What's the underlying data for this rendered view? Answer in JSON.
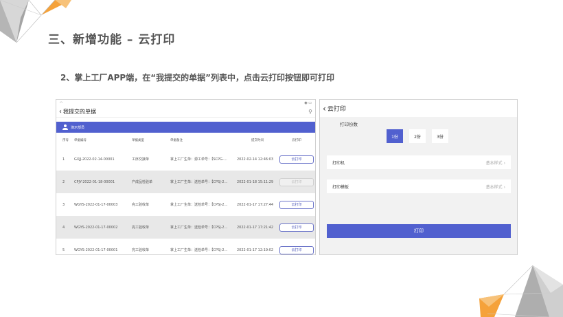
{
  "slide": {
    "title": "三、新增功能 – 云打印",
    "subtitle": "2、掌上工厂APP端，在“我提交的单据”列表中，点击云打印按钮即可打印"
  },
  "left_app": {
    "header_title": "我提交的单据",
    "dept_label": "演示部员",
    "columns": [
      "序号",
      "单据编号",
      "单据类型",
      "单据备注",
      "提交时间",
      "云打印"
    ],
    "rows": [
      {
        "no": "1",
        "code": "GXJJ-2022-02-14-00001",
        "type": "工序交接单",
        "note": "掌上工厂生单：源工单号：【SCPG-…",
        "time": "2022-02-14 12:46:03",
        "action": "云打印",
        "enabled": true
      },
      {
        "no": "2",
        "code": "CPJY-2022-01-18-00001",
        "type": "产成品检验单",
        "note": "掌上工厂生单：送检单号：【CPSJ-2…",
        "time": "2022-01-18 15:11:29",
        "action": "云打印",
        "enabled": false
      },
      {
        "no": "3",
        "code": "WGYS-2022-01-17-00003",
        "type": "完工验收单",
        "note": "掌上工厂生单：送检单号：【CPSJ-2…",
        "time": "2022-01-17 17:27:44",
        "action": "云打印",
        "enabled": true
      },
      {
        "no": "4",
        "code": "WGYS-2022-01-17-00002",
        "type": "完工验收单",
        "note": "掌上工厂生单：送检单号：【CPSJ-2…",
        "time": "2022-01-17 17:21:42",
        "action": "云打印",
        "enabled": true
      },
      {
        "no": "5",
        "code": "WGYS-2022-01-17-00001",
        "type": "完工验收单",
        "note": "掌上工厂生单：送检单号：【CPSJ-2…",
        "time": "2022-01-17 12:19:02",
        "action": "云打印",
        "enabled": true
      }
    ]
  },
  "right_app": {
    "header_title": "云打印",
    "copies_label": "打印份数",
    "copies": [
      "1份",
      "2份",
      "3份"
    ],
    "selected_copy": "1份",
    "printer_label": "打印机",
    "printer_value": "基本样式",
    "template_label": "打印模板",
    "template_value": "基本样式",
    "submit_label": "打印"
  },
  "colors": {
    "accent": "#5160cf",
    "deco_orange": "#f5a23a",
    "deco_gray": "#b8b8b8"
  }
}
